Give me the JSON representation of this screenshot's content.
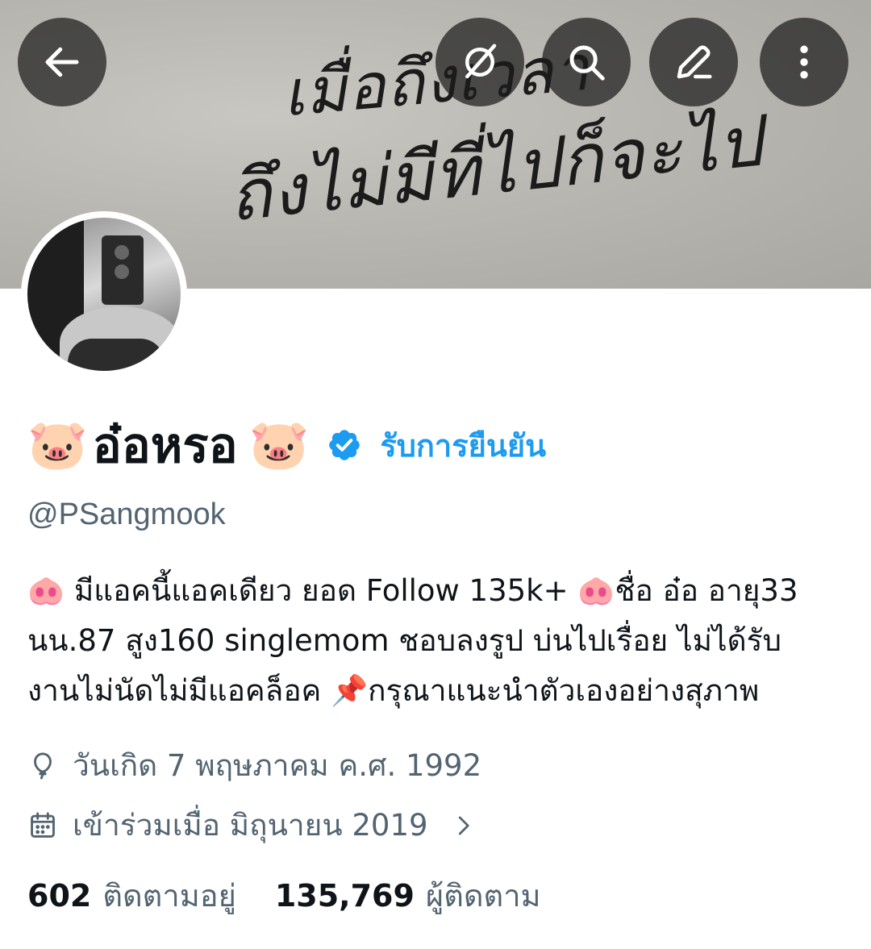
{
  "banner": {
    "handwriting_line1": "เมื่อถึงเวลา",
    "handwriting_line2": "ถึงไม่มีที่ไปก็จะไป"
  },
  "toolbar": {
    "back_icon": "arrow-left-icon",
    "grok_icon": "grok-icon",
    "search_icon": "search-icon",
    "edit_icon": "pencil-icon",
    "more_icon": "more-vertical-icon"
  },
  "profile": {
    "name_emoji_left": "🐷",
    "display_name": "อ๋อหรอ",
    "name_emoji_right": "🐷",
    "verified_icon": "verified-badge-icon",
    "verify_link": "รับการยืนยัน",
    "handle": "@PSangmook",
    "bio_lines": [
      "🐽 มีแอคนี้แอคเดียว ยอด Follow 135k+ 🐽ชื่อ อ๋อ  อายุ33",
      "นน.87 สูง160 singlemom ชอบลงรูป บ่นไปเรื่อย ไม่ได้รับ",
      "งานไม่นัดไม่มีแอคล็อค 📌กรุณาแนะนำตัวเองอย่างสุภาพ"
    ],
    "birthday_icon": "balloon-icon",
    "birthday": "วันเกิด 7 พฤษภาคม ค.ศ. 1992",
    "joined_icon": "calendar-icon",
    "joined": "เข้าร่วมเมื่อ มิถุนายน 2019",
    "following_count": "602",
    "following_label": "ติดตามอยู่",
    "followers_count": "135,769",
    "followers_label": "ผู้ติดตาม"
  },
  "colors": {
    "accent": "#1d9bf0",
    "secondary_text": "#536471",
    "primary_text": "#0f1419"
  }
}
